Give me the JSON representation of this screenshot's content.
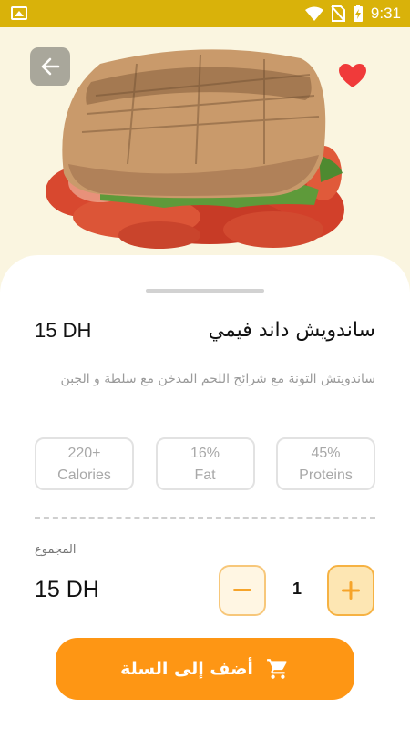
{
  "status_bar": {
    "time": "9:31",
    "icons": [
      "gallery-icon",
      "wifi-icon",
      "no-sim-icon",
      "battery-charging-icon"
    ]
  },
  "product": {
    "name": "ساندويش داند فيمي",
    "price": "15 DH",
    "description": "ساندويتش التونة مع شرائح اللحم المدخن مع سلطة و الجبن",
    "image_icon": "sandwich-image"
  },
  "nutrition": [
    {
      "value": "220+",
      "label": "Calories"
    },
    {
      "value": "16%",
      "label": "Fat"
    },
    {
      "value": "45%",
      "label": "Proteins"
    }
  ],
  "order": {
    "total_label": "المجموع",
    "total_price": "15 DH",
    "quantity": "1"
  },
  "actions": {
    "add_to_cart_label": "أضف إلى السلة",
    "back_icon": "arrow-left-icon",
    "favorite_icon": "heart-icon",
    "cart_icon": "cart-icon",
    "minus_icon": "minus-icon",
    "plus_icon": "plus-icon"
  },
  "colors": {
    "accent": "#fe9614",
    "status_bar": "#d9b20a",
    "hero_bg": "#faf5e0",
    "favorite": "#f03a3a"
  }
}
